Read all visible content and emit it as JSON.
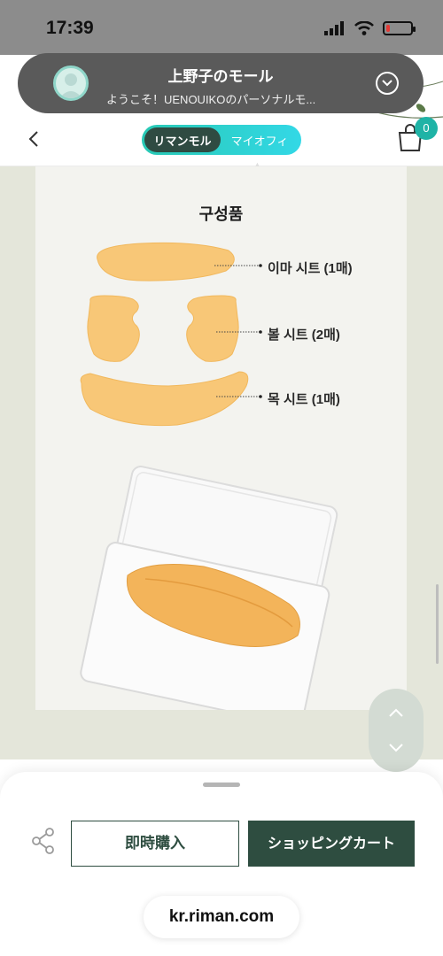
{
  "status_bar": {
    "time": "17:39",
    "battery_level": 0.15
  },
  "store": {
    "name": "上野子のモール",
    "welcome": "ようこそ！UENOUIKOのパーソナルモ..."
  },
  "nav": {
    "tab_active": "リマンモル",
    "tab_inactive": "マイオフィ",
    "cart_count": "0"
  },
  "product": {
    "section_title": "구성품",
    "components": [
      {
        "label": "이마 시트 (1매)"
      },
      {
        "label": "볼 시트 (2매)"
      },
      {
        "label": "목 시트 (1매)"
      }
    ]
  },
  "actions": {
    "buy_now": "即時購入",
    "add_to_cart": "ショッピングカート"
  },
  "browser": {
    "url": "kr.riman.com"
  },
  "colors": {
    "brand_green": "#2e4d40",
    "accent_teal": "#1fb3a6",
    "sheet_orange": "#f8c777"
  }
}
